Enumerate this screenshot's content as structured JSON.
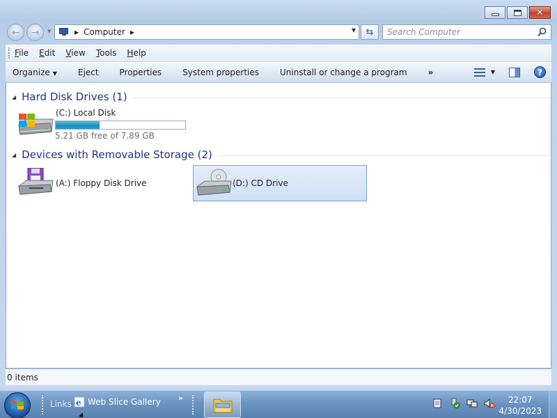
{
  "window": {
    "caption_buttons": [
      "minimize",
      "maximize",
      "close"
    ]
  },
  "navigation": {
    "breadcrumb": [
      "Computer"
    ],
    "search": {
      "placeholder": "Search Computer",
      "value": ""
    }
  },
  "menubar": {
    "items": [
      {
        "accel": "F",
        "rest": "ile"
      },
      {
        "accel": "E",
        "rest": "dit"
      },
      {
        "accel": "V",
        "rest": "iew"
      },
      {
        "accel": "T",
        "rest": "ools"
      },
      {
        "accel": "H",
        "rest": "elp"
      }
    ]
  },
  "commandbar": {
    "organize": "Organize",
    "eject": "Eject",
    "properties": "Properties",
    "system_properties": "System properties",
    "uninstall": "Uninstall or change a program",
    "more": "»"
  },
  "content": {
    "groups": [
      {
        "title": "Hard Disk Drives (1)",
        "drives": [
          {
            "label": "(C:) Local Disk",
            "free_text": "5.21 GB free of 7.89 GB",
            "used_fraction": 0.34,
            "icon": "hard-disk-icon"
          }
        ]
      },
      {
        "title": "Devices with Removable Storage (2)",
        "drives": [
          {
            "label": "(A:) Floppy Disk Drive",
            "icon": "floppy-drive-icon",
            "selected": false
          },
          {
            "label": "(D:) CD Drive",
            "icon": "cd-drive-icon",
            "selected": true
          }
        ]
      }
    ]
  },
  "statusbar": {
    "text": "0 items"
  },
  "taskbar": {
    "links_label": "Links",
    "web_slice": "Web Slice Gallery",
    "chevron": "»",
    "clock_time": "22:07",
    "clock_date": "4/30/2023",
    "tray_icons": [
      "action-center-icon",
      "usb-icon",
      "network-icon",
      "volume-muted-icon"
    ]
  },
  "colors": {
    "group_header": "#1e3287",
    "usage_bar": "#23a2cf",
    "selection": "#cfe0f6"
  }
}
